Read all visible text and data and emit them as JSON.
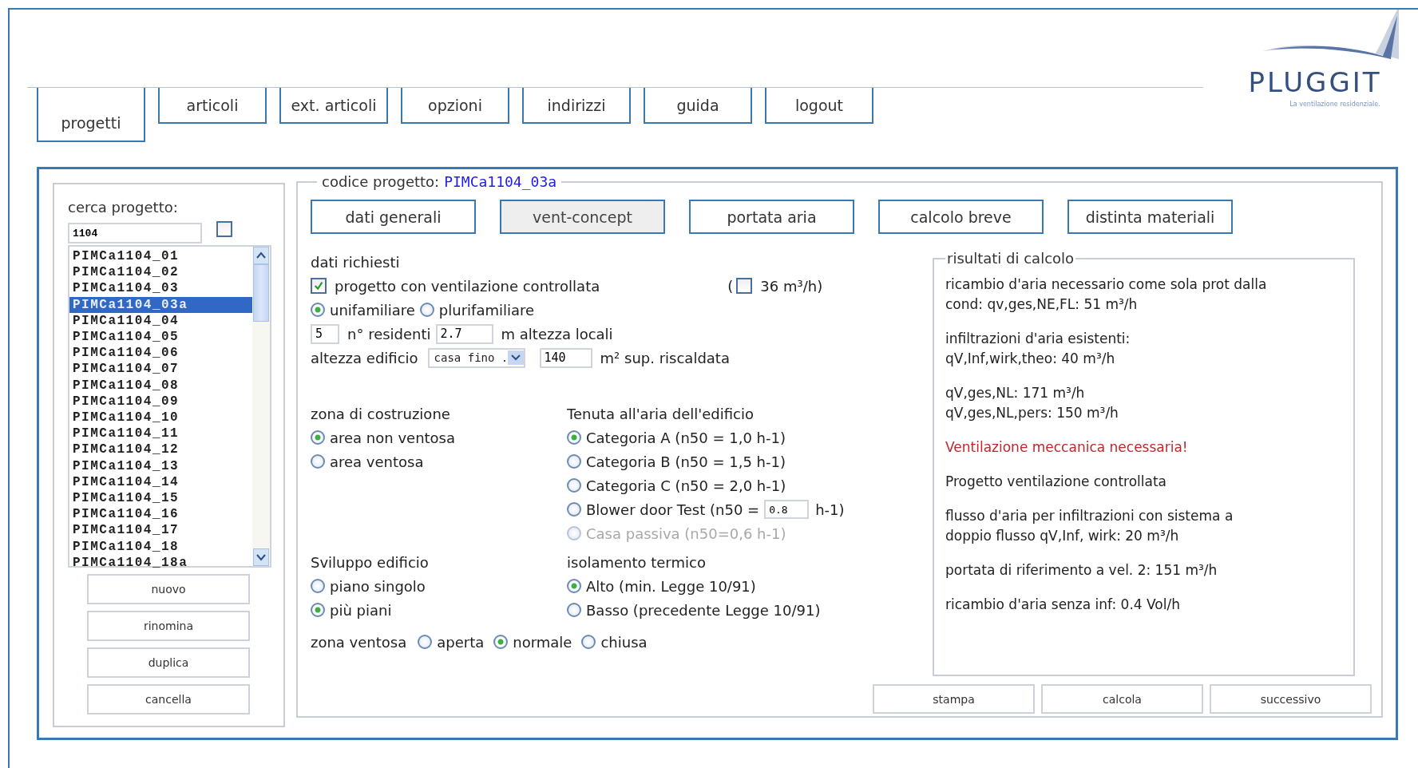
{
  "logo": {
    "name": "PLUGGIT",
    "tagline": "La ventilazione residenziale."
  },
  "nav_tabs": [
    {
      "label": "progetti",
      "selected": true
    },
    {
      "label": "articoli",
      "selected": false
    },
    {
      "label": "ext. articoli",
      "selected": false
    },
    {
      "label": "opzioni",
      "selected": false
    },
    {
      "label": "indirizzi",
      "selected": false
    },
    {
      "label": "guida",
      "selected": false
    },
    {
      "label": "logout",
      "selected": false
    }
  ],
  "sidebar": {
    "search_label": "cerca progetto:",
    "search_value": "1104",
    "filter_checked": false,
    "projects": [
      {
        "label": "PIMCa1104_01",
        "selected": false
      },
      {
        "label": "PIMCa1104_02",
        "selected": false
      },
      {
        "label": "PIMCa1104_03",
        "selected": false
      },
      {
        "label": "PIMCa1104_03a",
        "selected": true
      },
      {
        "label": "PIMCa1104_04",
        "selected": false
      },
      {
        "label": "PIMCa1104_05",
        "selected": false
      },
      {
        "label": "PIMCa1104_06",
        "selected": false
      },
      {
        "label": "PIMCa1104_07",
        "selected": false
      },
      {
        "label": "PIMCa1104_08",
        "selected": false
      },
      {
        "label": "PIMCa1104_09",
        "selected": false
      },
      {
        "label": "PIMCa1104_10",
        "selected": false
      },
      {
        "label": "PIMCa1104_11",
        "selected": false
      },
      {
        "label": "PIMCa1104_12",
        "selected": false
      },
      {
        "label": "PIMCa1104_13",
        "selected": false
      },
      {
        "label": "PIMCa1104_14",
        "selected": false
      },
      {
        "label": "PIMCa1104_15",
        "selected": false
      },
      {
        "label": "PIMCa1104_16",
        "selected": false
      },
      {
        "label": "PIMCa1104_17",
        "selected": false
      },
      {
        "label": "PIMCa1104_18",
        "selected": false
      },
      {
        "label": "PIMCa1104_18a",
        "selected": false
      }
    ],
    "buttons": [
      "nuovo",
      "rinomina",
      "duplica",
      "cancella"
    ]
  },
  "project": {
    "code_label": "codice progetto:",
    "code": "PIMCa1104_03a",
    "tabs": [
      {
        "label": "dati generali",
        "selected": false
      },
      {
        "label": "vent-concept",
        "selected": true
      },
      {
        "label": "portata aria",
        "selected": false
      },
      {
        "label": "calcolo breve",
        "selected": false
      },
      {
        "label": "distinta materiali",
        "selected": false
      }
    ],
    "required": {
      "title": "dati richiesti",
      "ventilation": {
        "label": "progetto con ventilazione controllata",
        "checked": true
      },
      "extra": {
        "prefix": "(",
        "checked": false,
        "label": "36 m³/h)"
      },
      "house_type": [
        {
          "label": "unifamiliare",
          "selected": true
        },
        {
          "label": "plurifamiliare",
          "selected": false
        }
      ],
      "residents": {
        "value": "5",
        "label": "n° residenti"
      },
      "room_height": {
        "value": "2.7",
        "label": "m altezza locali"
      },
      "building_height": {
        "label": "altezza edificio",
        "value": "casa fino ."
      },
      "area": {
        "value": "140",
        "label": "m² sup. riscaldata"
      },
      "groups": [
        {
          "title": "zona di costruzione",
          "options": [
            {
              "label": "area non ventosa",
              "selected": true,
              "disabled": false
            },
            {
              "label": "area ventosa",
              "selected": false,
              "disabled": false
            }
          ]
        },
        {
          "title": "Tenuta all'aria dell'edificio",
          "options": [
            {
              "label": "Categoria A (n50 = 1,0 h-1)",
              "selected": true,
              "disabled": false
            },
            {
              "label": "Categoria B (n50 = 1,5 h-1)",
              "selected": false,
              "disabled": false
            },
            {
              "label": "Categoria C (n50 = 2,0 h-1)",
              "selected": false,
              "disabled": false
            },
            {
              "label": "Blower door Test (n50 =",
              "selected": false,
              "disabled": false,
              "input_value": "0.8",
              "suffix": "h-1)"
            },
            {
              "label": "Casa passiva (n50=0,6 h-1)",
              "selected": false,
              "disabled": true
            }
          ]
        },
        {
          "title": "Sviluppo edificio",
          "options": [
            {
              "label": "piano singolo",
              "selected": false,
              "disabled": false
            },
            {
              "label": "più piani",
              "selected": true,
              "disabled": false
            }
          ]
        },
        {
          "title": "isolamento termico",
          "options": [
            {
              "label": "Alto (min. Legge 10/91)",
              "selected": true,
              "disabled": false
            },
            {
              "label": "Basso (precedente Legge 10/91)",
              "selected": false,
              "disabled": false
            }
          ]
        }
      ],
      "wind_zone": {
        "label": "zona ventosa",
        "options": [
          {
            "label": "aperta",
            "selected": false
          },
          {
            "label": "normale",
            "selected": true
          },
          {
            "label": "chiusa",
            "selected": false
          }
        ]
      }
    },
    "results": {
      "title": "risultati di calcolo",
      "paragraphs": [
        {
          "kind": "normal",
          "lines": [
            "ricambio d'aria necessario come sola prot dalla",
            "cond: qv,ges,NE,FL: 51 m³/h"
          ]
        },
        {
          "kind": "normal",
          "lines": [
            "infiltrazioni d'aria esistenti:",
            "qV,Inf,wirk,theo: 40 m³/h"
          ]
        },
        {
          "kind": "normal",
          "lines": [
            "qV,ges,NL: 171 m³/h",
            "qV,ges,NL,pers: 150 m³/h"
          ]
        },
        {
          "kind": "warning",
          "lines": [
            "Ventilazione meccanica necessaria!"
          ]
        },
        {
          "kind": "normal",
          "lines": [
            "Progetto ventilazione controllata"
          ]
        },
        {
          "kind": "normal",
          "lines": [
            "flusso d'aria per infiltrazioni con sistema a",
            "doppio flusso qV,Inf, wirk: 20 m³/h"
          ]
        },
        {
          "kind": "normal",
          "lines": [
            "portata di riferimento a vel. 2: 151 m³/h"
          ]
        },
        {
          "kind": "normal",
          "lines": [
            "ricambio d'aria senza inf: 0.4 Vol/h"
          ]
        }
      ]
    },
    "buttons": [
      "stampa",
      "calcola",
      "successivo"
    ]
  }
}
